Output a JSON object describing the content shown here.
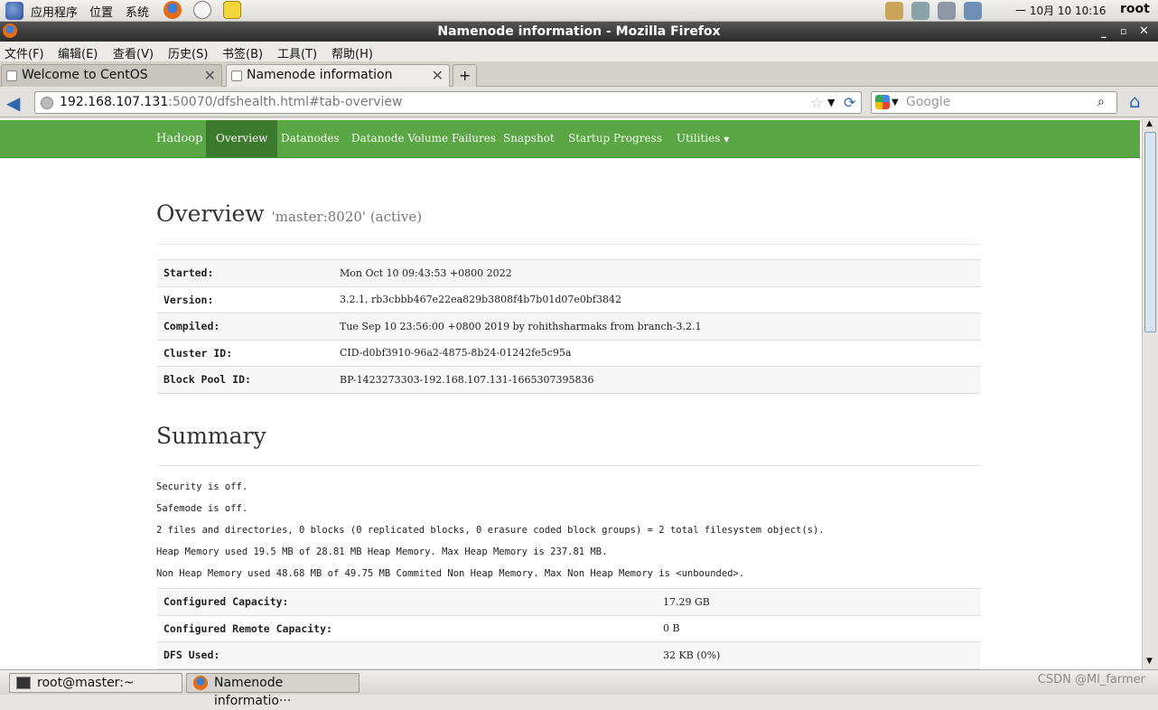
{
  "topbar": {
    "apps": "应用程序",
    "places": "位置",
    "system": "系统",
    "clock": "一 10月 10 10:16",
    "user": "root"
  },
  "window": {
    "title": "Namenode information - Mozilla Firefox"
  },
  "menu": [
    "文件(F)",
    "编辑(E)",
    "查看(V)",
    "历史(S)",
    "书签(B)",
    "工具(T)",
    "帮助(H)"
  ],
  "tabs": [
    {
      "label": "Welcome to CentOS"
    },
    {
      "label": "Namenode information"
    }
  ],
  "nav": {
    "url_host": "192.168.107.131",
    "url_rest": ":50070/dfshealth.html#tab-overview",
    "search_placeholder": "Google"
  },
  "hadoop_nav": {
    "brand": "Hadoop",
    "items": [
      "Overview",
      "Datanodes",
      "Datanode Volume Failures",
      "Snapshot",
      "Startup Progress",
      "Utilities"
    ]
  },
  "overview": {
    "title": "Overview",
    "subtitle": "'master:8020' (active)",
    "rows": [
      {
        "k": "Started:",
        "v": "Mon Oct 10 09:43:53 +0800 2022"
      },
      {
        "k": "Version:",
        "v": "3.2.1, rb3cbbb467e22ea829b3808f4b7b01d07e0bf3842"
      },
      {
        "k": "Compiled:",
        "v": "Tue Sep 10 23:56:00 +0800 2019 by rohithsharmaks from branch-3.2.1"
      },
      {
        "k": "Cluster ID:",
        "v": "CID-d0bf3910-96a2-4875-8b24-01242fe5c95a"
      },
      {
        "k": "Block Pool ID:",
        "v": "BP-1423273303-192.168.107.131-1665307395836"
      }
    ]
  },
  "summary": {
    "title": "Summary",
    "lines": [
      "Security is off.",
      "Safemode is off.",
      "2 files and directories, 0 blocks (0 replicated blocks, 0 erasure coded block groups) = 2 total filesystem object(s).",
      "Heap Memory used 19.5 MB of 28.81 MB Heap Memory. Max Heap Memory is 237.81 MB.",
      "Non Heap Memory used 48.68 MB of 49.75 MB Commited Non Heap Memory. Max Non Heap Memory is <unbounded>."
    ],
    "rows": [
      {
        "k": "Configured Capacity:",
        "v": "17.29 GB"
      },
      {
        "k": "Configured Remote Capacity:",
        "v": "0 B"
      },
      {
        "k": "DFS Used:",
        "v": "32 KB (0%)"
      }
    ]
  },
  "taskbar": {
    "items": [
      "root@master:~",
      "Namenode informatio···"
    ],
    "watermark": "CSDN @Ml_farmer"
  }
}
